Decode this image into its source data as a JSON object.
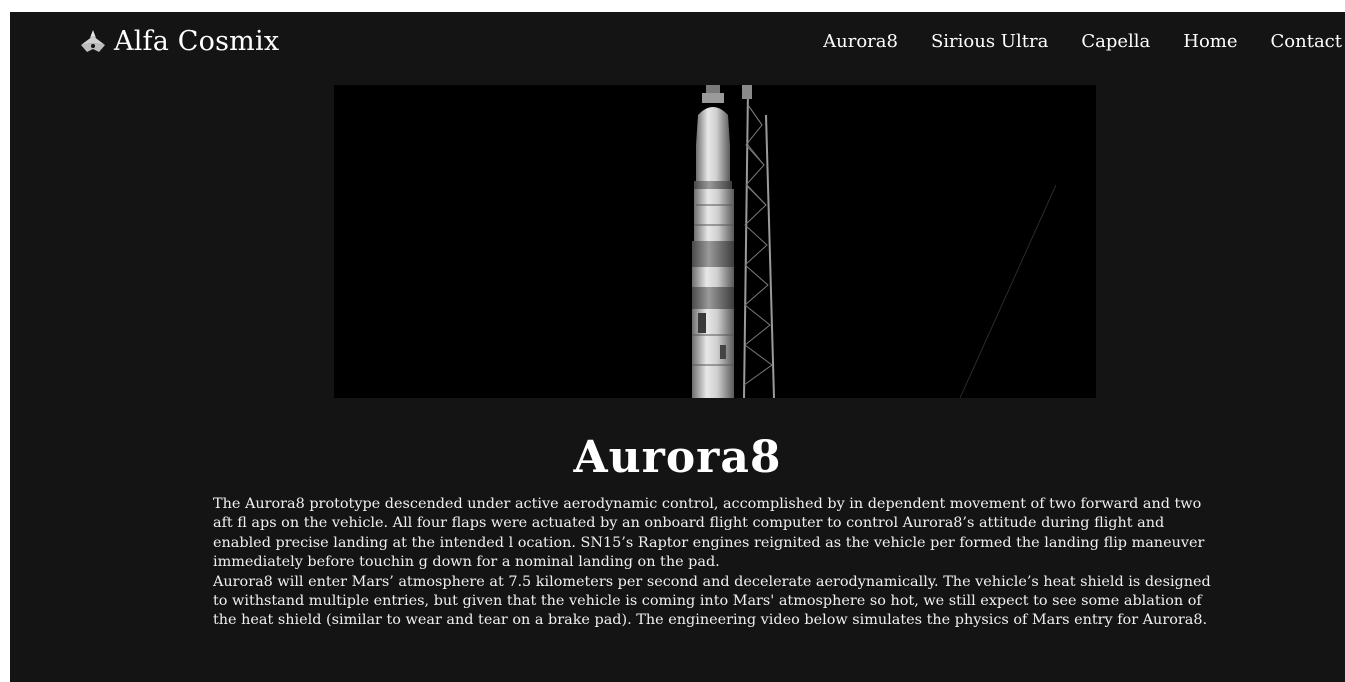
{
  "site": {
    "name": "Alfa Cosmix",
    "logo_icon": "ship-icon"
  },
  "nav": {
    "items": [
      {
        "label": "Aurora8"
      },
      {
        "label": "Sirious Ultra"
      },
      {
        "label": "Capella"
      },
      {
        "label": "Home"
      },
      {
        "label": "Contact"
      }
    ]
  },
  "hero": {
    "image": "rocket-on-launchpad-photo"
  },
  "article": {
    "title": "Aurora8",
    "paragraphs": [
      "The Aurora8 prototype descended under active aerodynamic control, accomplished by in dependent movement of two forward and two aft fl aps on the vehicle. All four flaps were actuated by an onboard flight computer to control Aurora8’s attitude during flight and enabled precise landing at the intended l ocation. SN15’s Raptor engines reignited as the vehicle per formed the landing flip maneuver immediately before touchin g down for a nominal landing on the pad.",
      "Aurora8 will enter Mars’ atmosphere at 7.5 kilometers per second and decelerate aerodynamically. The vehicle’s heat shield is designed to withstand multiple entries, but given that the vehicle is coming into Mars' atmosphere so hot, we still expect to see some ablation of the heat shield (similar to wear and tear on a brake pad). The engineering video below simulates the physics of Mars entry for Aurora8."
    ]
  },
  "colors": {
    "background": "#141414",
    "text": "#ffffff",
    "hero_background": "#000000"
  }
}
